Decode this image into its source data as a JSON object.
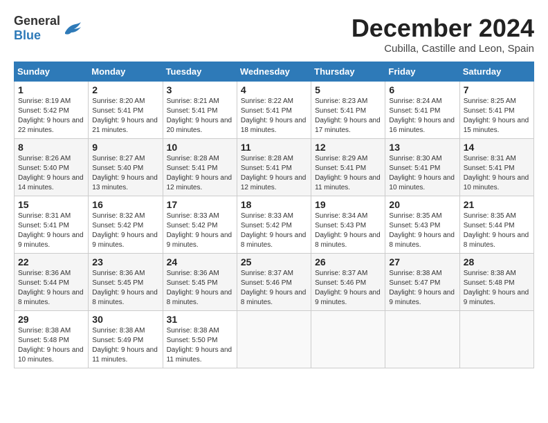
{
  "header": {
    "logo_general": "General",
    "logo_blue": "Blue",
    "month_title": "December 2024",
    "subtitle": "Cubilla, Castille and Leon, Spain"
  },
  "days_of_week": [
    "Sunday",
    "Monday",
    "Tuesday",
    "Wednesday",
    "Thursday",
    "Friday",
    "Saturday"
  ],
  "weeks": [
    [
      {
        "day": "1",
        "sunrise": "8:19 AM",
        "sunset": "5:42 PM",
        "daylight": "9 hours and 22 minutes."
      },
      {
        "day": "2",
        "sunrise": "8:20 AM",
        "sunset": "5:41 PM",
        "daylight": "9 hours and 21 minutes."
      },
      {
        "day": "3",
        "sunrise": "8:21 AM",
        "sunset": "5:41 PM",
        "daylight": "9 hours and 20 minutes."
      },
      {
        "day": "4",
        "sunrise": "8:22 AM",
        "sunset": "5:41 PM",
        "daylight": "9 hours and 18 minutes."
      },
      {
        "day": "5",
        "sunrise": "8:23 AM",
        "sunset": "5:41 PM",
        "daylight": "9 hours and 17 minutes."
      },
      {
        "day": "6",
        "sunrise": "8:24 AM",
        "sunset": "5:41 PM",
        "daylight": "9 hours and 16 minutes."
      },
      {
        "day": "7",
        "sunrise": "8:25 AM",
        "sunset": "5:41 PM",
        "daylight": "9 hours and 15 minutes."
      }
    ],
    [
      {
        "day": "8",
        "sunrise": "8:26 AM",
        "sunset": "5:40 PM",
        "daylight": "9 hours and 14 minutes."
      },
      {
        "day": "9",
        "sunrise": "8:27 AM",
        "sunset": "5:40 PM",
        "daylight": "9 hours and 13 minutes."
      },
      {
        "day": "10",
        "sunrise": "8:28 AM",
        "sunset": "5:41 PM",
        "daylight": "9 hours and 12 minutes."
      },
      {
        "day": "11",
        "sunrise": "8:28 AM",
        "sunset": "5:41 PM",
        "daylight": "9 hours and 12 minutes."
      },
      {
        "day": "12",
        "sunrise": "8:29 AM",
        "sunset": "5:41 PM",
        "daylight": "9 hours and 11 minutes."
      },
      {
        "day": "13",
        "sunrise": "8:30 AM",
        "sunset": "5:41 PM",
        "daylight": "9 hours and 10 minutes."
      },
      {
        "day": "14",
        "sunrise": "8:31 AM",
        "sunset": "5:41 PM",
        "daylight": "9 hours and 10 minutes."
      }
    ],
    [
      {
        "day": "15",
        "sunrise": "8:31 AM",
        "sunset": "5:41 PM",
        "daylight": "9 hours and 9 minutes."
      },
      {
        "day": "16",
        "sunrise": "8:32 AM",
        "sunset": "5:42 PM",
        "daylight": "9 hours and 9 minutes."
      },
      {
        "day": "17",
        "sunrise": "8:33 AM",
        "sunset": "5:42 PM",
        "daylight": "9 hours and 9 minutes."
      },
      {
        "day": "18",
        "sunrise": "8:33 AM",
        "sunset": "5:42 PM",
        "daylight": "9 hours and 8 minutes."
      },
      {
        "day": "19",
        "sunrise": "8:34 AM",
        "sunset": "5:43 PM",
        "daylight": "9 hours and 8 minutes."
      },
      {
        "day": "20",
        "sunrise": "8:35 AM",
        "sunset": "5:43 PM",
        "daylight": "9 hours and 8 minutes."
      },
      {
        "day": "21",
        "sunrise": "8:35 AM",
        "sunset": "5:44 PM",
        "daylight": "9 hours and 8 minutes."
      }
    ],
    [
      {
        "day": "22",
        "sunrise": "8:36 AM",
        "sunset": "5:44 PM",
        "daylight": "9 hours and 8 minutes."
      },
      {
        "day": "23",
        "sunrise": "8:36 AM",
        "sunset": "5:45 PM",
        "daylight": "9 hours and 8 minutes."
      },
      {
        "day": "24",
        "sunrise": "8:36 AM",
        "sunset": "5:45 PM",
        "daylight": "9 hours and 8 minutes."
      },
      {
        "day": "25",
        "sunrise": "8:37 AM",
        "sunset": "5:46 PM",
        "daylight": "9 hours and 8 minutes."
      },
      {
        "day": "26",
        "sunrise": "8:37 AM",
        "sunset": "5:46 PM",
        "daylight": "9 hours and 9 minutes."
      },
      {
        "day": "27",
        "sunrise": "8:38 AM",
        "sunset": "5:47 PM",
        "daylight": "9 hours and 9 minutes."
      },
      {
        "day": "28",
        "sunrise": "8:38 AM",
        "sunset": "5:48 PM",
        "daylight": "9 hours and 9 minutes."
      }
    ],
    [
      {
        "day": "29",
        "sunrise": "8:38 AM",
        "sunset": "5:48 PM",
        "daylight": "9 hours and 10 minutes."
      },
      {
        "day": "30",
        "sunrise": "8:38 AM",
        "sunset": "5:49 PM",
        "daylight": "9 hours and 11 minutes."
      },
      {
        "day": "31",
        "sunrise": "8:38 AM",
        "sunset": "5:50 PM",
        "daylight": "9 hours and 11 minutes."
      },
      null,
      null,
      null,
      null
    ]
  ]
}
